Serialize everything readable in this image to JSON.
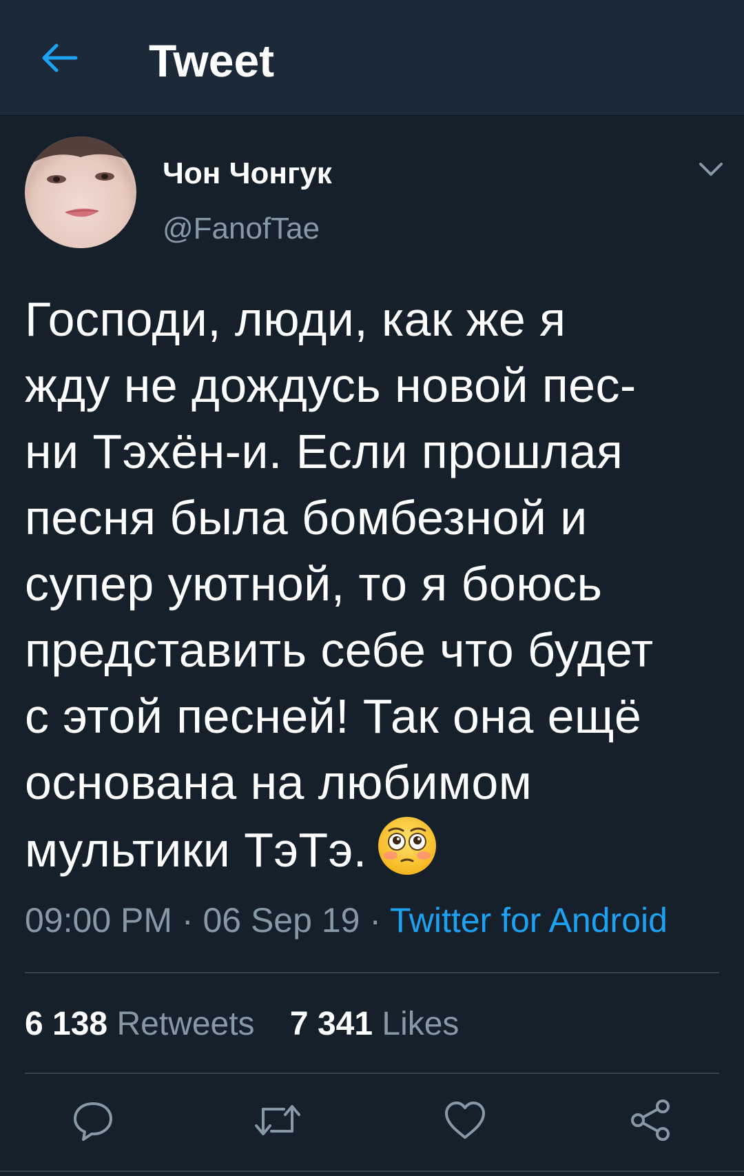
{
  "header": {
    "title": "Tweet",
    "back_icon": "arrow-left-icon",
    "accent_color": "#1da1f2"
  },
  "tweet": {
    "author": {
      "display_name": "Чон Чонгук",
      "handle": "@FanofTae"
    },
    "text_lines": [
      "Господи, люди, как же я",
      "жду не дождусь новой пес-",
      "ни Тэхён-и. Если прошлая",
      "песня была бомбезной и",
      "супер уютной, то я боюсь",
      "представить себе что будет",
      "с этой песней! Так она ещё",
      "основана на любимом",
      "мультики ТэТэ."
    ],
    "emoji": "flushed-face-icon",
    "time": "09:00 PM",
    "separator": " · ",
    "date": "06 Sep 19",
    "source": "Twitter for Android",
    "stats": {
      "retweets_count": "6 138",
      "retweets_label": "Retweets",
      "likes_count": "7 341",
      "likes_label": "Likes"
    }
  },
  "actions": [
    "reply-icon",
    "retweet-icon",
    "like-icon",
    "share-icon"
  ],
  "colors": {
    "background": "#15202b",
    "header_background": "#1c2938",
    "secondary_text": "#8899a6",
    "divider": "#38444d"
  }
}
